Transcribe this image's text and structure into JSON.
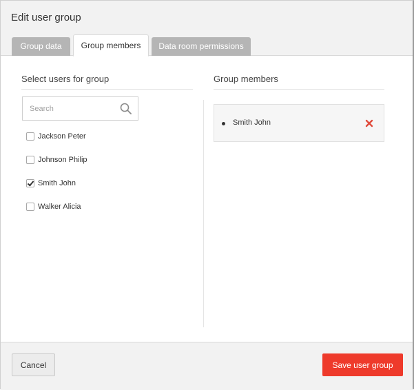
{
  "dialog": {
    "title": "Edit user group"
  },
  "tabs": [
    {
      "label": "Group data",
      "active": false
    },
    {
      "label": "Group members",
      "active": true
    },
    {
      "label": "Data room permissions",
      "active": false
    }
  ],
  "left_panel": {
    "heading": "Select users for group",
    "search": {
      "placeholder": "Search",
      "value": "",
      "icon": "search-icon"
    },
    "users": [
      {
        "label": "Jackson Peter",
        "checked": false
      },
      {
        "label": "Johnson Philip",
        "checked": false
      },
      {
        "label": "Smith John",
        "checked": true
      },
      {
        "label": "Walker Alicia",
        "checked": false
      }
    ]
  },
  "right_panel": {
    "heading": "Group members",
    "members": [
      {
        "name": "Smith John",
        "remove_icon": "close-icon"
      }
    ]
  },
  "footer": {
    "cancel_label": "Cancel",
    "save_label": "Save user group"
  },
  "colors": {
    "accent": "#ee3a2b",
    "remove": "#e04b3c",
    "tab_inactive": "#b5b5b5",
    "header_bg": "#f2f2f2"
  }
}
